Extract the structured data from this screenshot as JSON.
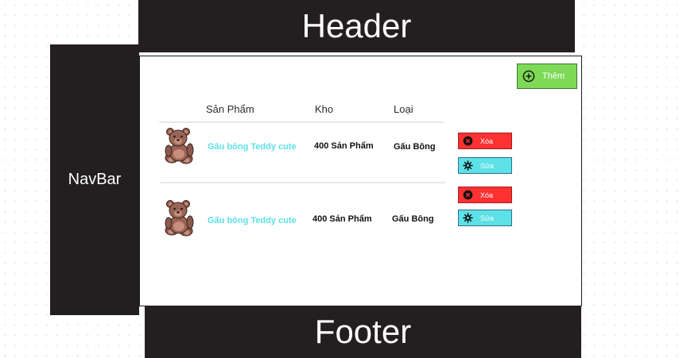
{
  "header": {
    "label": "Header"
  },
  "navbar": {
    "label": "NavBar"
  },
  "footer": {
    "label": "Footer"
  },
  "toolbar": {
    "add_label": "Thêm",
    "add_icon": "plus-circle-icon"
  },
  "table": {
    "columns": [
      "Sản Phẩm",
      "Kho",
      "Loại"
    ],
    "rows": [
      {
        "image": "teddy-bear-icon",
        "name": "Gấu bông Teddy cute",
        "stock": "400 Sản Phẩm",
        "category": "Gấu Bông",
        "delete_label": "Xóa",
        "edit_label": "Sửa"
      },
      {
        "image": "teddy-bear-icon",
        "name": "Gấu bông Teddy cute",
        "stock": "400 Sản Phẩm",
        "category": "Gấu Bông",
        "delete_label": "Xóa",
        "edit_label": "Sửa"
      }
    ]
  },
  "colors": {
    "block": "#231f20",
    "add": "#7ed957",
    "delete": "#ff3131",
    "edit": "#5ce1e6",
    "name_text": "#5ce1e6"
  }
}
